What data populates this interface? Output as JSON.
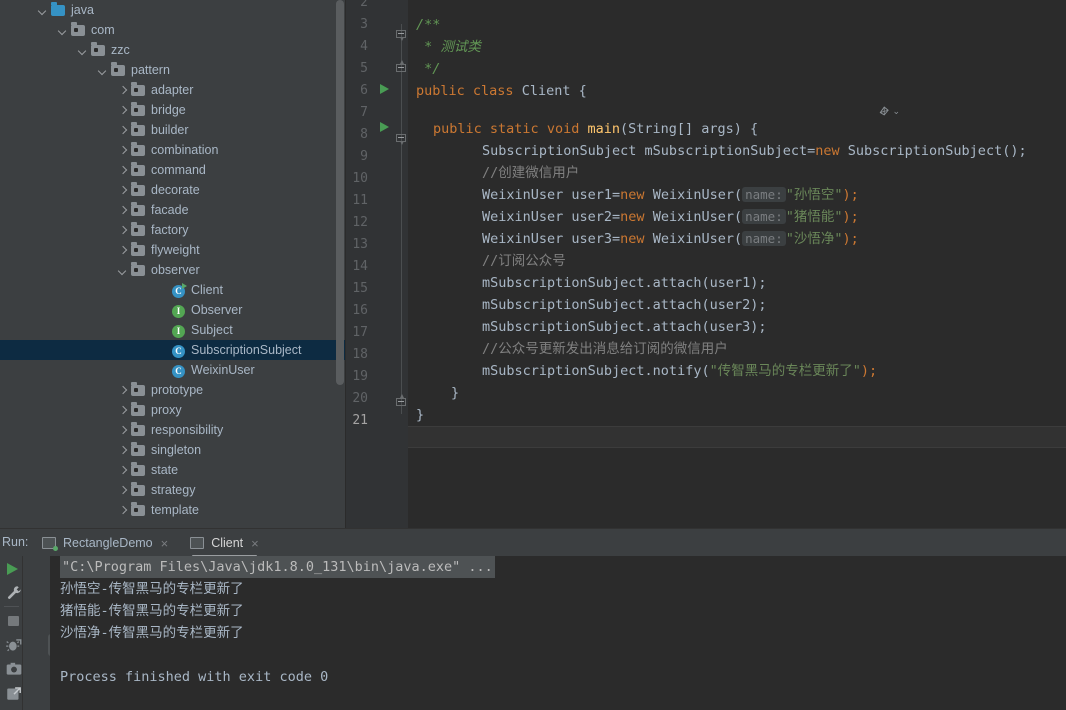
{
  "project_tree": {
    "items": [
      {
        "label": "java",
        "indent": 0,
        "arrow": "down",
        "icon": "folder-source-root-icon",
        "selected": false
      },
      {
        "label": "com",
        "indent": 1,
        "arrow": "down",
        "icon": "package-folder-icon",
        "selected": false
      },
      {
        "label": "zzc",
        "indent": 2,
        "arrow": "down",
        "icon": "package-folder-icon",
        "selected": false
      },
      {
        "label": "pattern",
        "indent": 3,
        "arrow": "down",
        "icon": "package-folder-icon",
        "selected": false
      },
      {
        "label": "adapter",
        "indent": 4,
        "arrow": "right",
        "icon": "package-folder-icon",
        "selected": false
      },
      {
        "label": "bridge",
        "indent": 4,
        "arrow": "right",
        "icon": "package-folder-icon",
        "selected": false
      },
      {
        "label": "builder",
        "indent": 4,
        "arrow": "right",
        "icon": "package-folder-icon",
        "selected": false
      },
      {
        "label": "combination",
        "indent": 4,
        "arrow": "right",
        "icon": "package-folder-icon",
        "selected": false
      },
      {
        "label": "command",
        "indent": 4,
        "arrow": "right",
        "icon": "package-folder-icon",
        "selected": false
      },
      {
        "label": "decorate",
        "indent": 4,
        "arrow": "right",
        "icon": "package-folder-icon",
        "selected": false
      },
      {
        "label": "facade",
        "indent": 4,
        "arrow": "right",
        "icon": "package-folder-icon",
        "selected": false
      },
      {
        "label": "factory",
        "indent": 4,
        "arrow": "right",
        "icon": "package-folder-icon",
        "selected": false
      },
      {
        "label": "flyweight",
        "indent": 4,
        "arrow": "right",
        "icon": "package-folder-icon",
        "selected": false
      },
      {
        "label": "observer",
        "indent": 4,
        "arrow": "down",
        "icon": "package-folder-icon",
        "selected": false
      },
      {
        "label": "Client",
        "indent": 6,
        "arrow": "none",
        "icon": "runnable-class-icon",
        "selected": false
      },
      {
        "label": "Observer",
        "indent": 6,
        "arrow": "none",
        "icon": "interface-icon",
        "selected": false
      },
      {
        "label": "Subject",
        "indent": 6,
        "arrow": "none",
        "icon": "interface-icon",
        "selected": false
      },
      {
        "label": "SubscriptionSubject",
        "indent": 6,
        "arrow": "none",
        "icon": "class-icon",
        "selected": true
      },
      {
        "label": "WeixinUser",
        "indent": 6,
        "arrow": "none",
        "icon": "class-icon",
        "selected": false
      },
      {
        "label": "prototype",
        "indent": 4,
        "arrow": "right",
        "icon": "package-folder-icon",
        "selected": false
      },
      {
        "label": "proxy",
        "indent": 4,
        "arrow": "right",
        "icon": "package-folder-icon",
        "selected": false
      },
      {
        "label": "responsibility",
        "indent": 4,
        "arrow": "right",
        "icon": "package-folder-icon",
        "selected": false
      },
      {
        "label": "singleton",
        "indent": 4,
        "arrow": "right",
        "icon": "package-folder-icon",
        "selected": false
      },
      {
        "label": "state",
        "indent": 4,
        "arrow": "right",
        "icon": "package-folder-icon",
        "selected": false
      },
      {
        "label": "strategy",
        "indent": 4,
        "arrow": "right",
        "icon": "package-folder-icon",
        "selected": false
      },
      {
        "label": "template",
        "indent": 4,
        "arrow": "right",
        "icon": "package-folder-icon",
        "selected": false
      }
    ]
  },
  "editor": {
    "first_line_number": 2,
    "last_line_number": 21,
    "current_line_number": 21,
    "line_numbers": [
      "2",
      "3",
      "4",
      "5",
      "6",
      "7",
      "8",
      "9",
      "10",
      "11",
      "12",
      "13",
      "14",
      "15",
      "16",
      "17",
      "18",
      "19",
      "20",
      "21"
    ],
    "run_markers_on_lines": [
      "6",
      "7"
    ],
    "fold_markers_on_lines": [
      "3",
      "5",
      "7",
      "19"
    ],
    "inlay_icon": "javadoc-render-icon",
    "lines": {
      "l3_doc_open": "/**",
      "l4_doc_text": " * 测试类",
      "l5_doc_close": " */",
      "l6_kw_public": "public",
      "l6_kw_class": "class",
      "l6_name": "Client",
      "l6_brace": "{",
      "l7_kw_public": "public",
      "l7_kw_static": "static",
      "l7_kw_void": "void",
      "l7_name": "main",
      "l7_params": "(String[] args) {",
      "l8_type": "SubscriptionSubject mSubscriptionSubject=",
      "l8_kw_new": "new",
      "l8_ctor": " SubscriptionSubject();",
      "l9_comment": "//创建微信用户",
      "l10_decl": "WeixinUser user1=",
      "l10_kw_new": "new",
      "l10_ctor": " WeixinUser(",
      "l10_hint": "name:",
      "l10_str": "\"孙悟空\"",
      "l10_tail": ");",
      "l11_decl": "WeixinUser user2=",
      "l11_kw_new": "new",
      "l11_ctor": " WeixinUser(",
      "l11_hint": "name:",
      "l11_str": "\"猪悟能\"",
      "l11_tail": ");",
      "l12_decl": "WeixinUser user3=",
      "l12_kw_new": "new",
      "l12_ctor": " WeixinUser(",
      "l12_hint": "name:",
      "l12_str": "\"沙悟净\"",
      "l12_tail": ");",
      "l13_comment": "//订阅公众号",
      "l14_call": "mSubscriptionSubject.attach(user1);",
      "l15_call": "mSubscriptionSubject.attach(user2);",
      "l16_call": "mSubscriptionSubject.attach(user3);",
      "l17_comment": "//公众号更新发出消息给订阅的微信用户",
      "l18_call_head": "mSubscriptionSubject.notify(",
      "l18_str": "\"传智黑马的专栏更新了\"",
      "l18_tail": ");",
      "l19_brace": "}",
      "l20_brace": "}"
    }
  },
  "run_panel": {
    "title": "Run:",
    "tabs": [
      {
        "label": "RectangleDemo",
        "active": false,
        "running": true,
        "close": "×"
      },
      {
        "label": "Client",
        "active": true,
        "running": false,
        "close": "×"
      }
    ],
    "toolbar_left": [
      {
        "name": "rerun-button",
        "icon": "play-icon"
      },
      {
        "name": "edit-configurations-button",
        "icon": "wrench-icon"
      },
      {
        "name": "stop-button",
        "icon": "stop-square-icon"
      },
      {
        "name": "resume-button",
        "icon": "bug-exit-icon"
      },
      {
        "name": "camera-button",
        "icon": "camera-icon"
      },
      {
        "name": "export-button",
        "icon": "export-icon"
      }
    ],
    "toolbar_mid": [
      {
        "name": "scroll-up-button",
        "icon": "arrow-up-icon",
        "active": false
      },
      {
        "name": "scroll-down-button",
        "icon": "arrow-down-icon",
        "active": false
      },
      {
        "name": "soft-wrap-button",
        "icon": "soft-wrap-icon",
        "active": false
      },
      {
        "name": "scroll-to-end-button",
        "icon": "scroll-to-end-icon",
        "active": true
      },
      {
        "name": "print-button",
        "icon": "printer-icon",
        "active": false
      },
      {
        "name": "clear-all-button",
        "icon": "trash-icon",
        "active": false
      }
    ],
    "console": {
      "command": "\"C:\\Program Files\\Java\\jdk1.8.0_131\\bin\\java.exe\" ...",
      "output": [
        "孙悟空-传智黑马的专栏更新了",
        "猪悟能-传智黑马的专栏更新了",
        "沙悟净-传智黑马的专栏更新了",
        "",
        "Process finished with exit code 0"
      ]
    }
  },
  "colors": {
    "ide_bg": "#3c3f41",
    "editor_bg": "#2b2b2b",
    "gutter_bg": "#313335",
    "selection_bg": "#0d2b42",
    "keyword": "#cc7832",
    "string": "#6a8759",
    "comment": "#808080",
    "javadoc": "#629755",
    "method": "#ffc66d",
    "text": "#a9b7c6",
    "accent_green": "#499c54",
    "accent_blue": "#3592c4"
  }
}
